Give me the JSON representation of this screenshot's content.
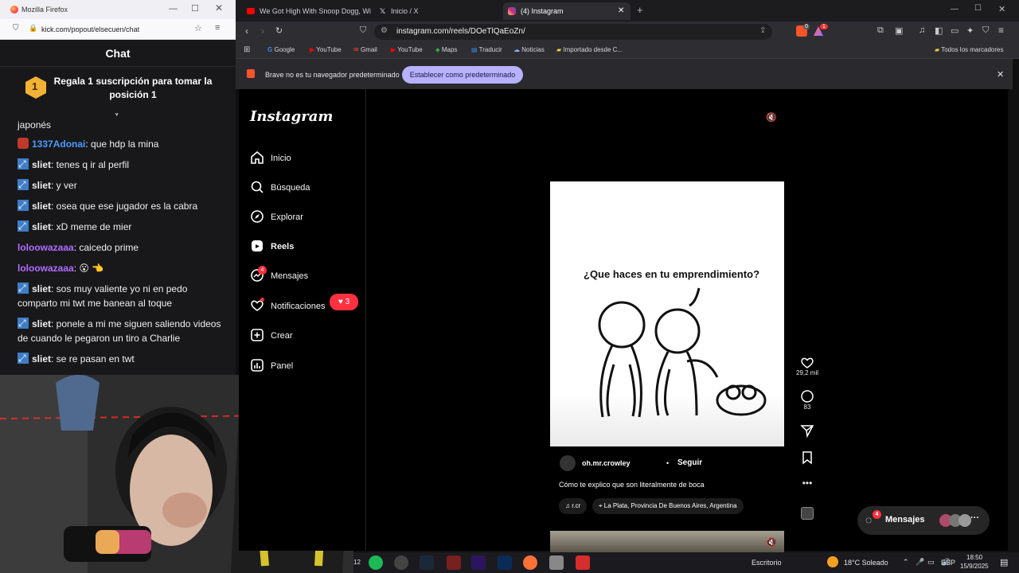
{
  "firefox": {
    "window_title": "Mozilla Firefox",
    "url": "kick.com/popout/elsecuen/chat",
    "chat_title": "Chat",
    "gift_rank": "1",
    "gift_text": "Regala 1 suscripción para tomar la posición 1",
    "messages": [
      {
        "user": "",
        "text": "japonés",
        "color": "#efeff1"
      },
      {
        "user": "1337Adonai",
        "text": ": que hdp la mina",
        "color": "#4e9bff",
        "badge": "red"
      },
      {
        "user": "sliet",
        "text": ": tenes q ir al perfil",
        "color": "#ffffff",
        "badge": "blue"
      },
      {
        "user": "sliet",
        "text": ": y ver",
        "color": "#ffffff",
        "badge": "blue"
      },
      {
        "user": "sliet",
        "text": ": osea que ese jugador es la cabra",
        "color": "#ffffff",
        "badge": "blue"
      },
      {
        "user": "sliet",
        "text": ": xD meme de mier",
        "color": "#ffffff",
        "badge": "blue"
      },
      {
        "user": "loloowazaaa",
        "text": ": caicedo prime",
        "color": "#b36bff",
        "badge": ""
      },
      {
        "user": "loloowazaaa",
        "text": ": 😮 👈",
        "color": "#b36bff",
        "badge": ""
      },
      {
        "user": "sliet",
        "text": ": sos muy valiente yo ni en pedo comparto mi twt me banean al toque",
        "color": "#ffffff",
        "badge": "blue"
      },
      {
        "user": "sliet",
        "text": ": ponele a mi me siguen saliendo videos de cuando le pegaron un tiro a Charlie",
        "color": "#ffffff",
        "badge": "blue"
      },
      {
        "user": "sliet",
        "text": ": se re pasan en twt",
        "color": "#ffffff",
        "badge": "blue"
      }
    ]
  },
  "brave": {
    "tabs": [
      {
        "label": "We Got High With Snoop Dogg, Wi",
        "icon": "youtube-icon"
      },
      {
        "label": "Inicio / X",
        "icon": "x-icon"
      },
      {
        "label": "(4) Instagram",
        "icon": "instagram-icon",
        "active": true
      }
    ],
    "url": "instagram.com/reels/DOeTlQaEoZn/",
    "shield_count": "0",
    "rewards_count": "1",
    "bookmarks": [
      {
        "label": "Google",
        "icon": "google-icon"
      },
      {
        "label": "YouTube",
        "icon": "youtube-icon"
      },
      {
        "label": "Gmail",
        "icon": "gmail-icon"
      },
      {
        "label": "YouTube",
        "icon": "youtube-icon"
      },
      {
        "label": "Maps",
        "icon": "maps-icon"
      },
      {
        "label": "Traducir",
        "icon": "translate-icon"
      },
      {
        "label": "Noticias",
        "icon": "news-icon"
      },
      {
        "label": "Importado desde C...",
        "icon": "folder-icon"
      }
    ],
    "all_bookmarks": "Todos los marcadores",
    "infobar_text": "Brave no es tu navegador predeterminado",
    "infobar_button": "Establecer como predeterminado"
  },
  "instagram": {
    "logo": "Instagram",
    "nav": [
      {
        "label": "Inicio",
        "icon": "home-icon"
      },
      {
        "label": "Búsqueda",
        "icon": "search-icon"
      },
      {
        "label": "Explorar",
        "icon": "compass-icon"
      },
      {
        "label": "Reels",
        "icon": "reels-icon",
        "active": true
      },
      {
        "label": "Mensajes",
        "icon": "messenger-icon",
        "badge": "4"
      },
      {
        "label": "Notificaciones",
        "icon": "heart-icon"
      },
      {
        "label": "Crear",
        "icon": "plus-square-icon"
      },
      {
        "label": "Panel",
        "icon": "chart-icon"
      }
    ],
    "notif_pill": "3",
    "reel": {
      "caption_overlay": "¿Que haces en tu emprendimiento?",
      "username": "oh.mr.crowley",
      "follow": "Seguir",
      "description": "Cómo te explico que son literalmente de boca",
      "audio": "r.cr",
      "location": "La Plata, Provincia De Buenos Aires, Argentina",
      "likes": "29,2 mil",
      "comments": "83"
    },
    "messages_button": "Mensajes",
    "messages_badge": "4"
  },
  "taskbar": {
    "left_badge": "12",
    "desktop_label": "Escritorio",
    "weather": "18°C  Soleado",
    "lang": "ESP",
    "time": "18:50",
    "date": "15/9/2025"
  }
}
